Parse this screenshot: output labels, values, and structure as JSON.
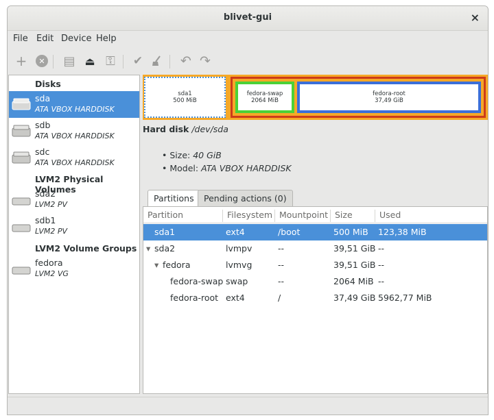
{
  "window": {
    "title": "blivet-gui",
    "close_glyph": "×"
  },
  "menu": [
    "File",
    "Edit",
    "Device",
    "Help"
  ],
  "toolbar": [
    {
      "name": "add-icon",
      "glyph": "+"
    },
    {
      "name": "delete-icon",
      "glyph": "✕"
    },
    {
      "name": "document-icon",
      "glyph": "▤"
    },
    {
      "name": "eject-icon",
      "glyph": "⏏"
    },
    {
      "name": "key-icon",
      "glyph": "⚿"
    },
    {
      "name": "apply-icon",
      "glyph": "✔"
    },
    {
      "name": "clear-icon",
      "glyph": "🧹"
    },
    {
      "name": "undo-icon",
      "glyph": "↶"
    },
    {
      "name": "redo-icon",
      "glyph": "↷"
    }
  ],
  "sidebar": {
    "disks_header": "Disks",
    "disks": [
      {
        "name": "sda",
        "desc": "ATA VBOX HARDDISK",
        "selected": true
      },
      {
        "name": "sdb",
        "desc": "ATA VBOX HARDDISK",
        "selected": false
      },
      {
        "name": "sdc",
        "desc": "ATA VBOX HARDDISK",
        "selected": false
      }
    ],
    "pv_header": "LVM2 Physical Volumes",
    "pvs": [
      {
        "name": "sda2",
        "desc": "LVM2 PV"
      },
      {
        "name": "sdb1",
        "desc": "LVM2 PV"
      }
    ],
    "vg_header": "LVM2 Volume Groups",
    "vgs": [
      {
        "name": "fedora",
        "desc": "LVM2 VG"
      }
    ]
  },
  "diskbar": {
    "sda1": {
      "name": "sda1",
      "size": "500 MiB"
    },
    "swap": {
      "name": "fedora-swap",
      "size": "2064 MiB"
    },
    "root": {
      "name": "fedora-root",
      "size": "37,49 GiB"
    },
    "colors": {
      "vg_outer": "#f6a827",
      "pv": "#cc3b1a",
      "swap": "#4cd137",
      "root": "#3b6fd9",
      "selected_border": "#4a90d9"
    }
  },
  "details": {
    "title_prefix": "Hard disk",
    "title_path": "/dev/sda",
    "size_label": "Size:",
    "size_value": "40 GiB",
    "model_label": "Model:",
    "model_value": "ATA VBOX HARDDISK"
  },
  "tabs": [
    {
      "label": "Partitions",
      "active": true
    },
    {
      "label": "Pending actions (0)",
      "active": false
    }
  ],
  "table": {
    "columns": [
      "Partition",
      "Filesystem",
      "Mountpoint",
      "Size",
      "Used"
    ],
    "rows": [
      {
        "partition": "sda1",
        "fs": "ext4",
        "mount": "/boot",
        "size": "500 MiB",
        "used": "123,38 MiB",
        "selected": true,
        "level": 0,
        "expander": false
      },
      {
        "partition": "sda2",
        "fs": "lvmpv",
        "mount": "--",
        "size": "39,51 GiB",
        "used": "--",
        "selected": false,
        "level": 0,
        "expander": true
      },
      {
        "partition": "fedora",
        "fs": "lvmvg",
        "mount": "--",
        "size": "39,51 GiB",
        "used": "--",
        "selected": false,
        "level": 1,
        "expander": true
      },
      {
        "partition": "fedora-swap",
        "fs": "swap",
        "mount": "--",
        "size": "2064 MiB",
        "used": "--",
        "selected": false,
        "level": 2,
        "expander": false
      },
      {
        "partition": "fedora-root",
        "fs": "ext4",
        "mount": "/",
        "size": "37,49 GiB",
        "used": "5962,77 MiB",
        "selected": false,
        "level": 2,
        "expander": false
      }
    ],
    "expander_glyph": "▾"
  }
}
